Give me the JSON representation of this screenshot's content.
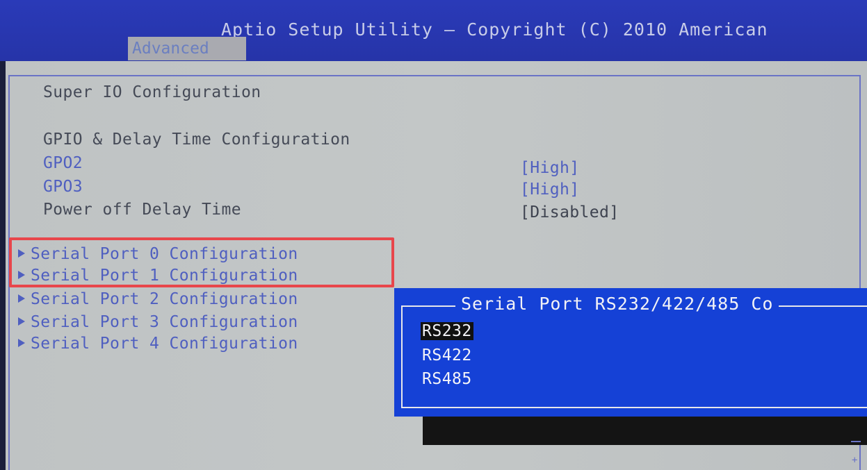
{
  "header": {
    "title": "Aptio Setup Utility – Copyright (C) 2010 American",
    "active_tab": "Advanced"
  },
  "main": {
    "section_title": "Super IO Configuration",
    "gpio_heading": "GPIO & Delay Time Configuration",
    "settings": [
      {
        "label": "GPO2",
        "value": "[High]"
      },
      {
        "label": "GPO3",
        "value": "[High]"
      },
      {
        "label": "Power off Delay Time",
        "value": "[Disabled]"
      }
    ],
    "submenus": [
      "Serial Port 0 Configuration",
      "Serial Port 1 Configuration",
      "Serial Port 2 Configuration",
      "Serial Port 3 Configuration",
      "Serial Port 4 Configuration"
    ]
  },
  "popup": {
    "title": "Serial Port RS232/422/485 Co",
    "options": [
      "RS232",
      "RS422",
      "RS485"
    ],
    "selected": "RS232"
  },
  "scrollbar": {
    "symbol": "+"
  },
  "colors": {
    "header_bg": "#2634a8",
    "screen_bg": "#c1c5c5",
    "popup_bg": "#1541d6",
    "highlight": "#e8464b",
    "menu_blue": "#4f5fc0"
  }
}
